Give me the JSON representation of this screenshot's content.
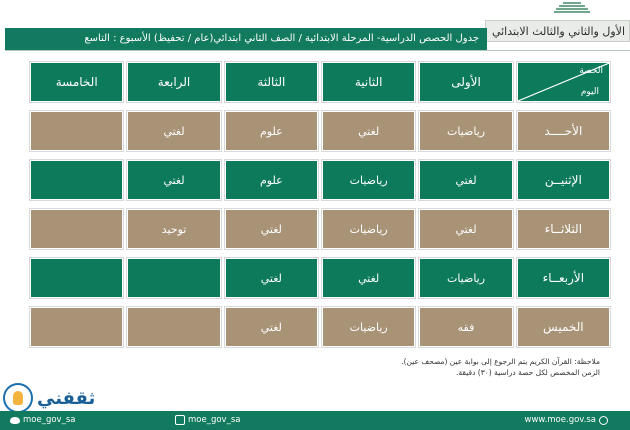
{
  "overlay_title": "الأول والثاني والثالث الابتدائي",
  "header": {
    "title": "جدول الحصص الدراسية- المرحلة الابتدائية / الصف الثاني ابتدائي(عام / تحفيظ) الأسبوع : التاسع"
  },
  "table": {
    "corner_top": "الحصة",
    "corner_bottom": "اليوم",
    "headers": [
      "الأولى",
      "الثانية",
      "الثالثة",
      "الرابعة",
      "الخامسة"
    ],
    "rows": [
      {
        "day": "الأحــــد",
        "color": "tan",
        "cells": [
          "رياضيات",
          "لغتي",
          "علوم",
          "لغتي",
          ""
        ]
      },
      {
        "day": "الإثنيــن",
        "color": "green",
        "cells": [
          "لغتي",
          "رياضيات",
          "علوم",
          "لغتي",
          ""
        ]
      },
      {
        "day": "الثلاثــاء",
        "color": "tan",
        "cells": [
          "لغتي",
          "رياضيات",
          "لغتي",
          "توحيد",
          ""
        ]
      },
      {
        "day": "الأربعــاء",
        "color": "green",
        "cells": [
          "رياضيات",
          "لغتي",
          "لغتي",
          "",
          ""
        ]
      },
      {
        "day": "الخميس",
        "color": "tan",
        "cells": [
          "فقه",
          "رياضيات",
          "لغتي",
          "",
          ""
        ]
      }
    ]
  },
  "notes": [
    "ملاحظة: القرآن الكريم يتم الرجوع إلى بوابة عين (مصحف عين).",
    "الزمن المخصص لكل حصة دراسية (٣٠) دقيقة."
  ],
  "watermark": {
    "text": "ثقفني"
  },
  "footer": {
    "twitter": "moe_gov_sa",
    "instagram": "moe_gov_sa",
    "website": "www.moe.gov.sa"
  },
  "colors": {
    "green": "#0e7a5c",
    "tan": "#a89377",
    "header_green": "#127a5e"
  }
}
